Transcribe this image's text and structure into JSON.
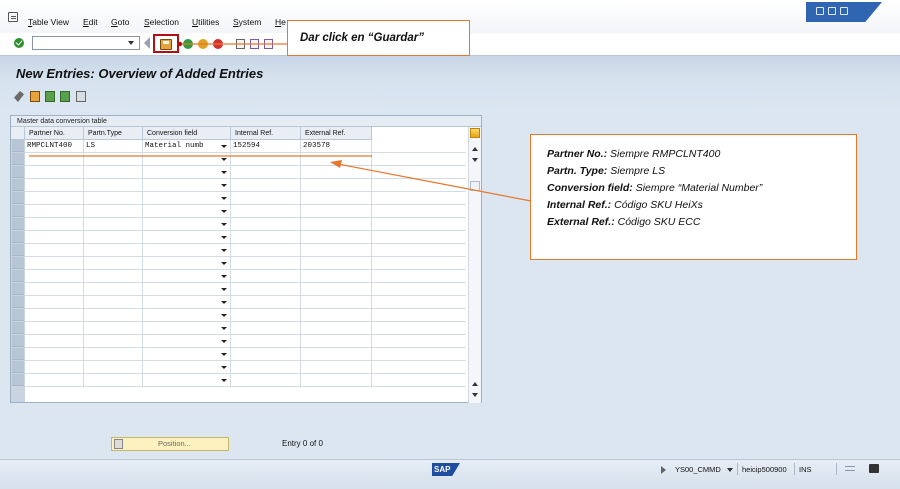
{
  "menubar": {
    "items": [
      "Table View",
      "Edit",
      "Goto",
      "Selection",
      "Utilities",
      "System",
      "He"
    ]
  },
  "toolbar": {
    "command_field_value": ""
  },
  "title": {
    "text": "New Entries: Overview of Added Entries"
  },
  "table": {
    "caption": "Master data conversion table",
    "columns": [
      "Partner No.",
      "Partn.Type",
      "Conversion field",
      "Internal Ref.",
      "External Ref."
    ],
    "rows": [
      [
        "RMPCLNT400",
        "LS",
        "Material numb",
        "152594",
        "203578"
      ]
    ],
    "empty_rows": 18
  },
  "position_button": {
    "label": "Position..."
  },
  "entry_text": "Entry 0 of 0",
  "callouts": {
    "save": "Dar click en “Guardar”",
    "info": [
      {
        "label": "Partner No.:",
        "value": "Siempre RMPCLNT400"
      },
      {
        "label": "Partn. Type:",
        "value": "Siempre LS"
      },
      {
        "label": "Conversion field:",
        "value": "Siempre “Material Number”"
      },
      {
        "label": "Internal Ref.:",
        "value": "Código SKU HeiXs"
      },
      {
        "label": "External Ref.:",
        "value": "Código SKU ECC"
      }
    ]
  },
  "statusbar": {
    "logo": "SAP",
    "transaction": "YS00_CMMD",
    "server": "heicip500900",
    "mode": "INS"
  },
  "colors": {
    "annotation_orange": "#e8772e",
    "highlight_red": "#b01010",
    "header_blue": "#dbe6f1"
  }
}
